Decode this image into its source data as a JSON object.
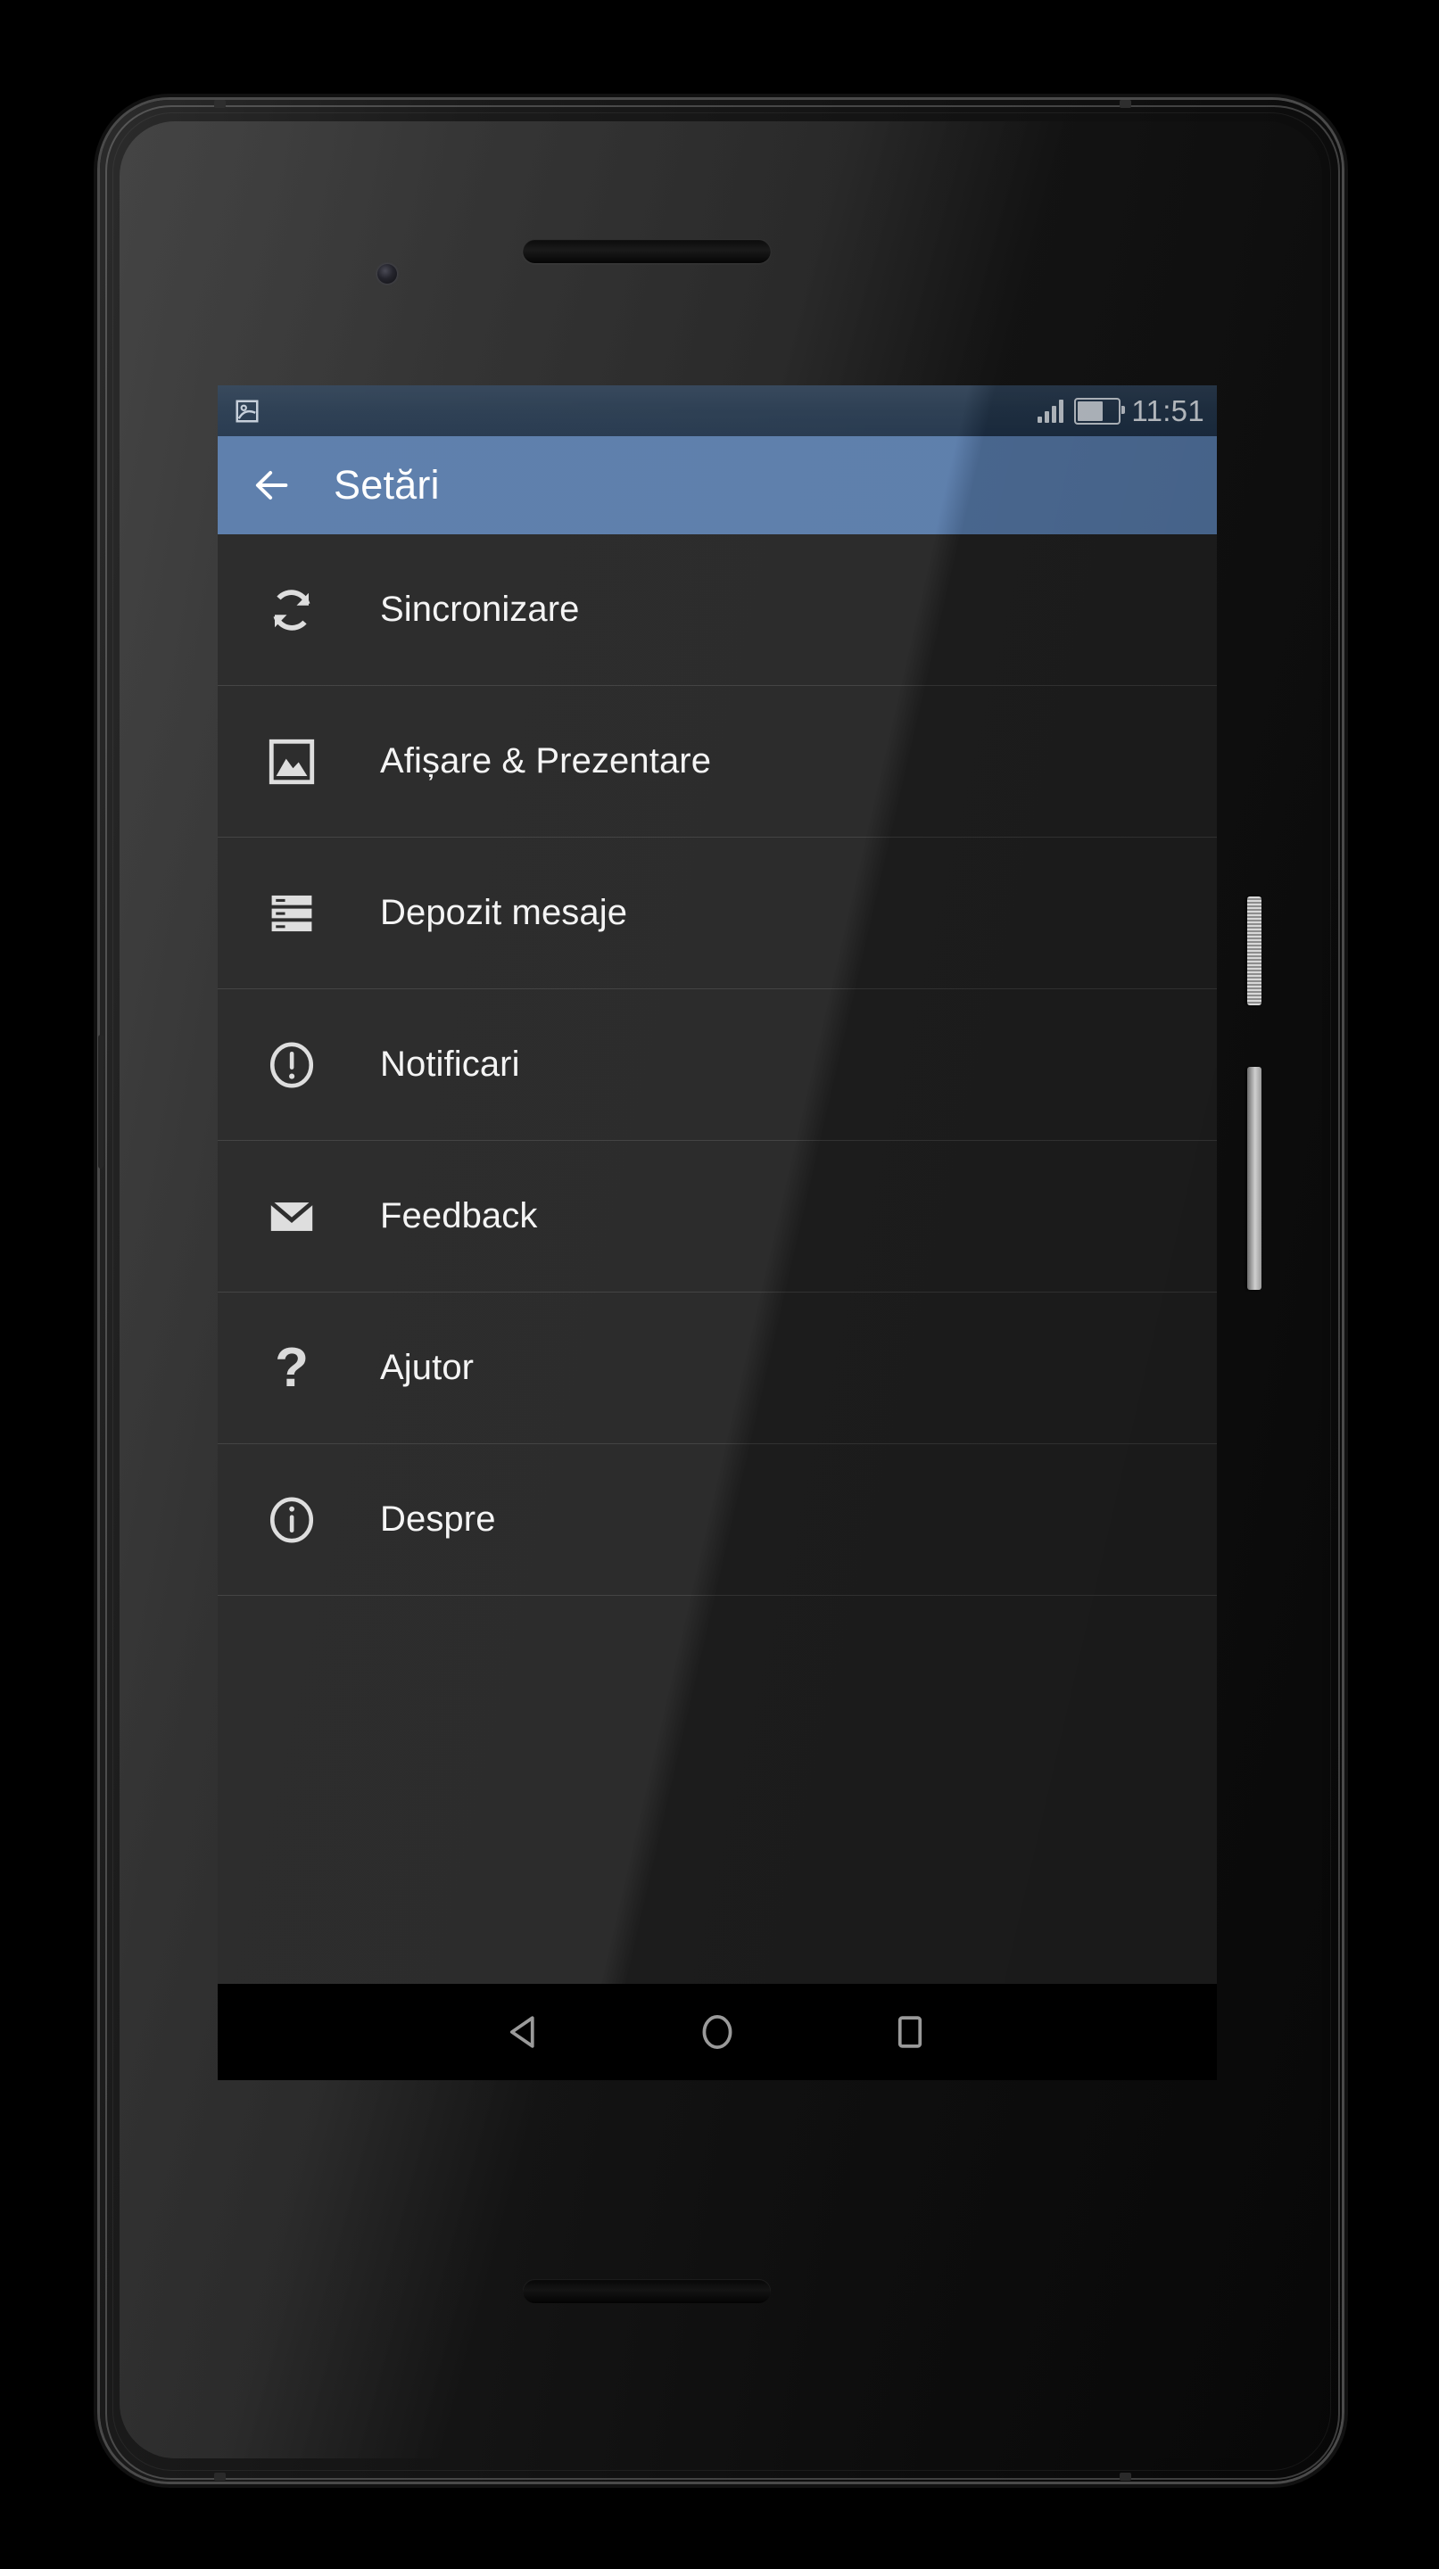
{
  "device": {
    "name": "android-phone",
    "frame_color": "#141414",
    "screen_bg": "#212121"
  },
  "status_bar": {
    "time": "11:51",
    "notification_icon": "photo-icon",
    "signal_icon": "signal-bars-icon",
    "signal_strength": 4,
    "battery_icon": "battery-icon",
    "battery_percent": 68,
    "bg_color": "#24374c",
    "text_color": "#d8dde3"
  },
  "app_bar": {
    "back_icon": "arrow-left-icon",
    "title": "Setări",
    "bg_color": "#5679a8",
    "text_color": "#ffffff"
  },
  "settings_list": {
    "divider_color": "#3a3a3a",
    "items": [
      {
        "label": "Sincronizare",
        "icon": "sync-icon"
      },
      {
        "label": "Afișare & Prezentare",
        "icon": "image-icon"
      },
      {
        "label": "Depozit mesaje",
        "icon": "storage-icon"
      },
      {
        "label": "Notificari",
        "icon": "alert-circle-icon"
      },
      {
        "label": "Feedback",
        "icon": "envelope-icon"
      },
      {
        "label": "Ajutor",
        "icon": "question-mark-icon"
      },
      {
        "label": "Despre",
        "icon": "info-circle-icon"
      }
    ]
  },
  "nav_bar": {
    "bg_color": "#000000",
    "buttons": [
      {
        "name": "back",
        "icon": "triangle-left-icon"
      },
      {
        "name": "home",
        "icon": "circle-icon"
      },
      {
        "name": "recents",
        "icon": "square-icon"
      }
    ]
  }
}
